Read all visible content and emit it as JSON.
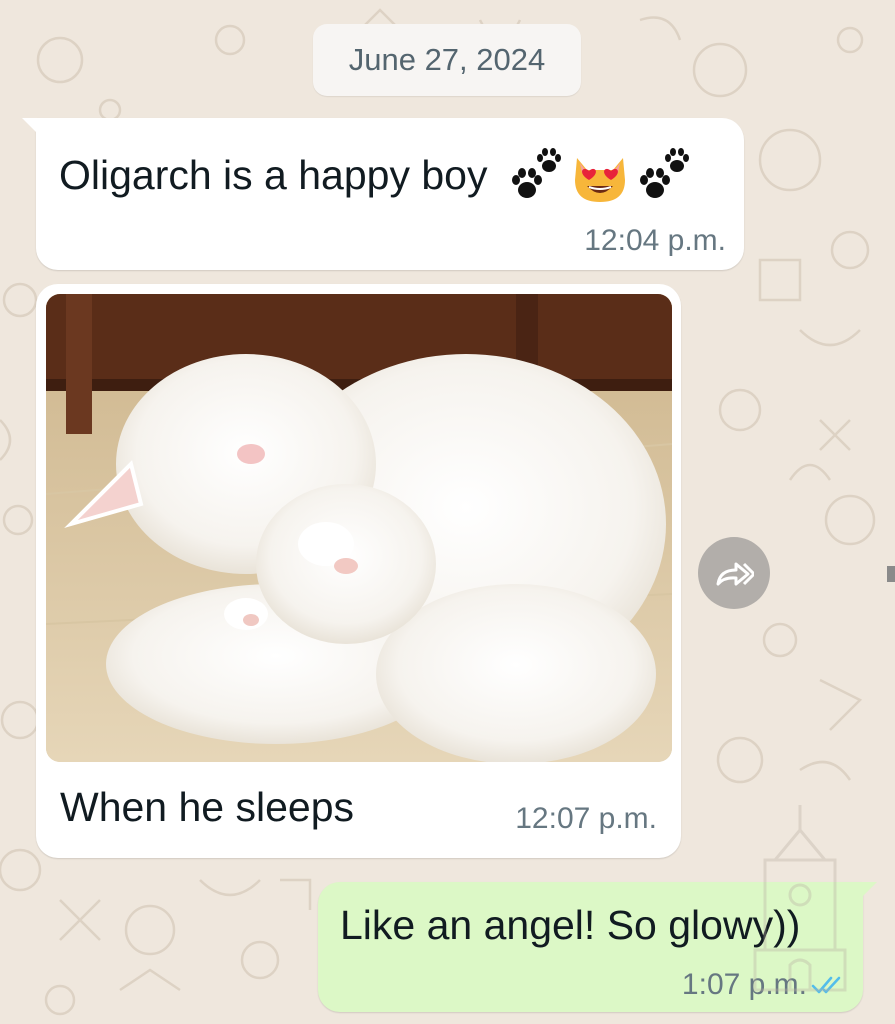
{
  "chat": {
    "date_separator": "June 27, 2024",
    "messages": [
      {
        "direction": "incoming",
        "text": "Oligarch is a happy boy",
        "emoji": [
          "paw-prints",
          "heart-eyes-cat",
          "paw-prints"
        ],
        "time": "12:04 p.m."
      },
      {
        "direction": "incoming",
        "media": "photo of a white fluffy cat sleeping curled up on a floor",
        "caption": "When he sleeps",
        "time": "12:07 p.m."
      },
      {
        "direction": "outgoing",
        "text": "Like an angel! So glowy))",
        "time": "1:07 p.m.",
        "status": "read-double-check"
      }
    ]
  },
  "colors": {
    "background": "#efe7dd",
    "incoming_bubble": "#ffffff",
    "outgoing_bubble": "#dcf8c6",
    "read_ticks": "#53bdeb"
  },
  "icons": {
    "forward_button": "forward-icon"
  }
}
